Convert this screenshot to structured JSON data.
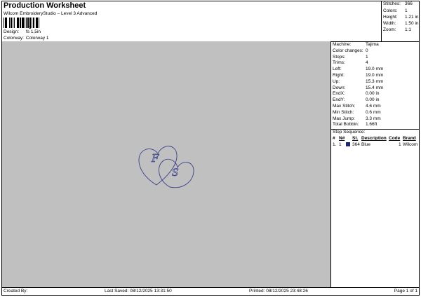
{
  "header": {
    "title": "Production Worksheet",
    "software": "Wilcom EmbroideryStudio – Level 3 Advanced",
    "barcode_caption": "1",
    "design_label": "Design:",
    "design_value": "fs 1,5in",
    "colorway_label": "Colorway:",
    "colorway_value": "Colorway 1"
  },
  "summary": {
    "stitches_label": "Stitches:",
    "stitches_value": "366",
    "colors_label": "Colors:",
    "colors_value": "1",
    "height_label": "Height:",
    "height_value": "1.21 in",
    "width_label": "Width:",
    "width_value": "1.50 in",
    "zoom_label": "Zoom:",
    "zoom_value": "1:1"
  },
  "details": [
    {
      "label": "Machine:",
      "value": "Tajima"
    },
    {
      "label": "Color changes:",
      "value": "0"
    },
    {
      "label": "Stops:",
      "value": "1"
    },
    {
      "label": "Trims:",
      "value": "4"
    },
    {
      "label": "Left:",
      "value": "19.0 mm"
    },
    {
      "label": "Right:",
      "value": "19.0 mm"
    },
    {
      "label": "Up:",
      "value": "15.3 mm"
    },
    {
      "label": "Down:",
      "value": "15.4 mm"
    },
    {
      "label": "EndX:",
      "value": "0.00 in"
    },
    {
      "label": "EndY:",
      "value": "0.00 in"
    },
    {
      "label": "Max Stitch:",
      "value": "4.6 mm"
    },
    {
      "label": "Min Stitch:",
      "value": "0.6 mm"
    },
    {
      "label": "Max Jump:",
      "value": "3.3 mm"
    },
    {
      "label": "Total Bobbin:",
      "value": "1.66ft"
    }
  ],
  "stop_sequence": {
    "title": "Stop Sequence:",
    "headers": {
      "num": "#",
      "n": "N#",
      "st": "St.",
      "description": "Description",
      "code": "Code",
      "brand": "Brand"
    },
    "rows": [
      {
        "num": "1.",
        "n": "1",
        "st": "364",
        "description": "Blue",
        "code": "1",
        "brand": "Wilcom",
        "color": "#1d2570"
      }
    ]
  },
  "design": {
    "thread_color": "#3b3f8c",
    "letter_1": "F",
    "letter_2": "S"
  },
  "footer": {
    "created_by": "Created By:",
    "last_saved": "Last Saved: 08/12/2025 13:31:50",
    "printed": "Printed: 08/12/2025 23:48:26",
    "page": "Page 1 of 1"
  }
}
